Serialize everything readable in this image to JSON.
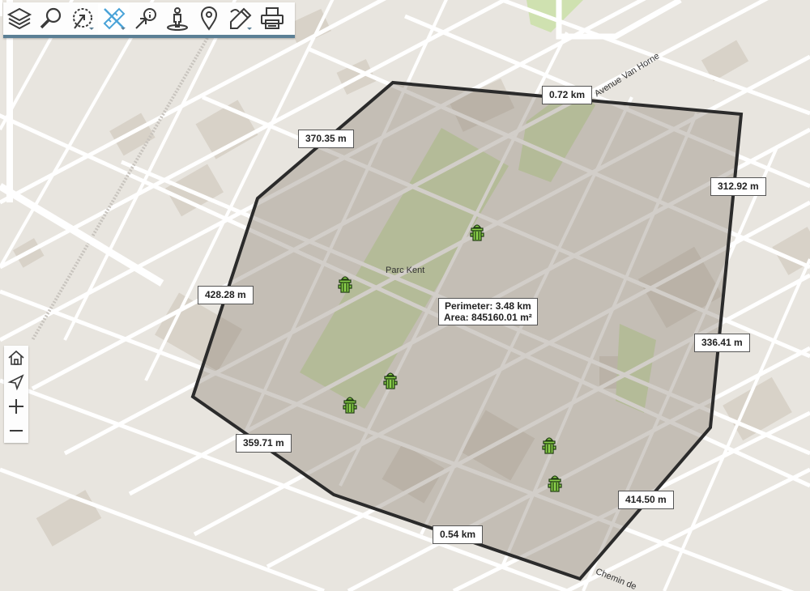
{
  "toolbar": {
    "buttons": [
      {
        "icon": "layers-icon",
        "label": "Layers"
      },
      {
        "icon": "search-icon",
        "label": "Search"
      },
      {
        "icon": "select-icon",
        "label": "Select"
      },
      {
        "icon": "measure-icon",
        "label": "Measure",
        "active": true
      },
      {
        "icon": "identify-icon",
        "label": "Identify"
      },
      {
        "icon": "streetview-icon",
        "label": "Street view"
      },
      {
        "icon": "location-pin-icon",
        "label": "Location"
      },
      {
        "icon": "draw-icon",
        "label": "Draw"
      },
      {
        "icon": "print-icon",
        "label": "Print"
      }
    ]
  },
  "zoom": {
    "buttons": [
      {
        "icon": "home-icon"
      },
      {
        "icon": "navigate-icon"
      },
      {
        "icon": "zoom-in-icon"
      },
      {
        "icon": "zoom-out-icon"
      }
    ]
  },
  "map": {
    "park_name": "Parc Kent",
    "street_1": "Avenue Van Horne",
    "street_2": "Chemin de",
    "colors": {
      "background": "#e8e5df",
      "street": "#ffffff",
      "building": "#d8d2c8",
      "park": "#cfe1b0",
      "polygon_fill": "#8a7e70",
      "polygon_stroke": "#2b2b2b",
      "accent": "#5b7f95"
    }
  },
  "measurement": {
    "segments": [
      "0.72 km",
      "370.35 m",
      "312.92 m",
      "428.28 m",
      "336.41 m",
      "359.71 m",
      "414.50 m",
      "0.54 km"
    ],
    "perimeter": "Perimeter: 3.48 km",
    "area": "Area: 845160.01 m²"
  }
}
